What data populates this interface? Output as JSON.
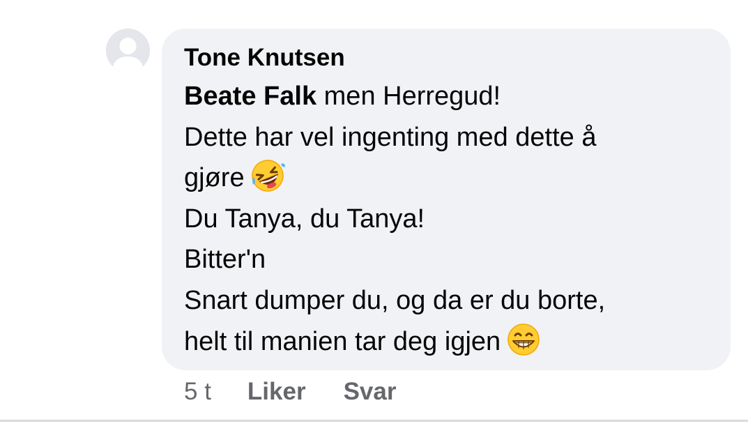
{
  "comment": {
    "author": "Tone Knutsen",
    "mention": "Beate Falk",
    "lines": [
      " men Herregud!",
      "Dette har vel ingenting med dette å",
      "gjøre",
      "Du Tanya, du Tanya!",
      "Bitter'n",
      "Snart dumper du, og da er du borte,",
      "helt til manien tar deg igjen"
    ],
    "emojis": {
      "line3": "rolling-on-floor-laughing-emoji",
      "line7": "grinning-face-emoji"
    }
  },
  "actions": {
    "time": "5 t",
    "like_label": "Liker",
    "reply_label": "Svar"
  },
  "colors": {
    "bubble_bg": "#f0f2f5",
    "meta_text": "#65676b",
    "avatar_bg": "#e4e6eb"
  }
}
